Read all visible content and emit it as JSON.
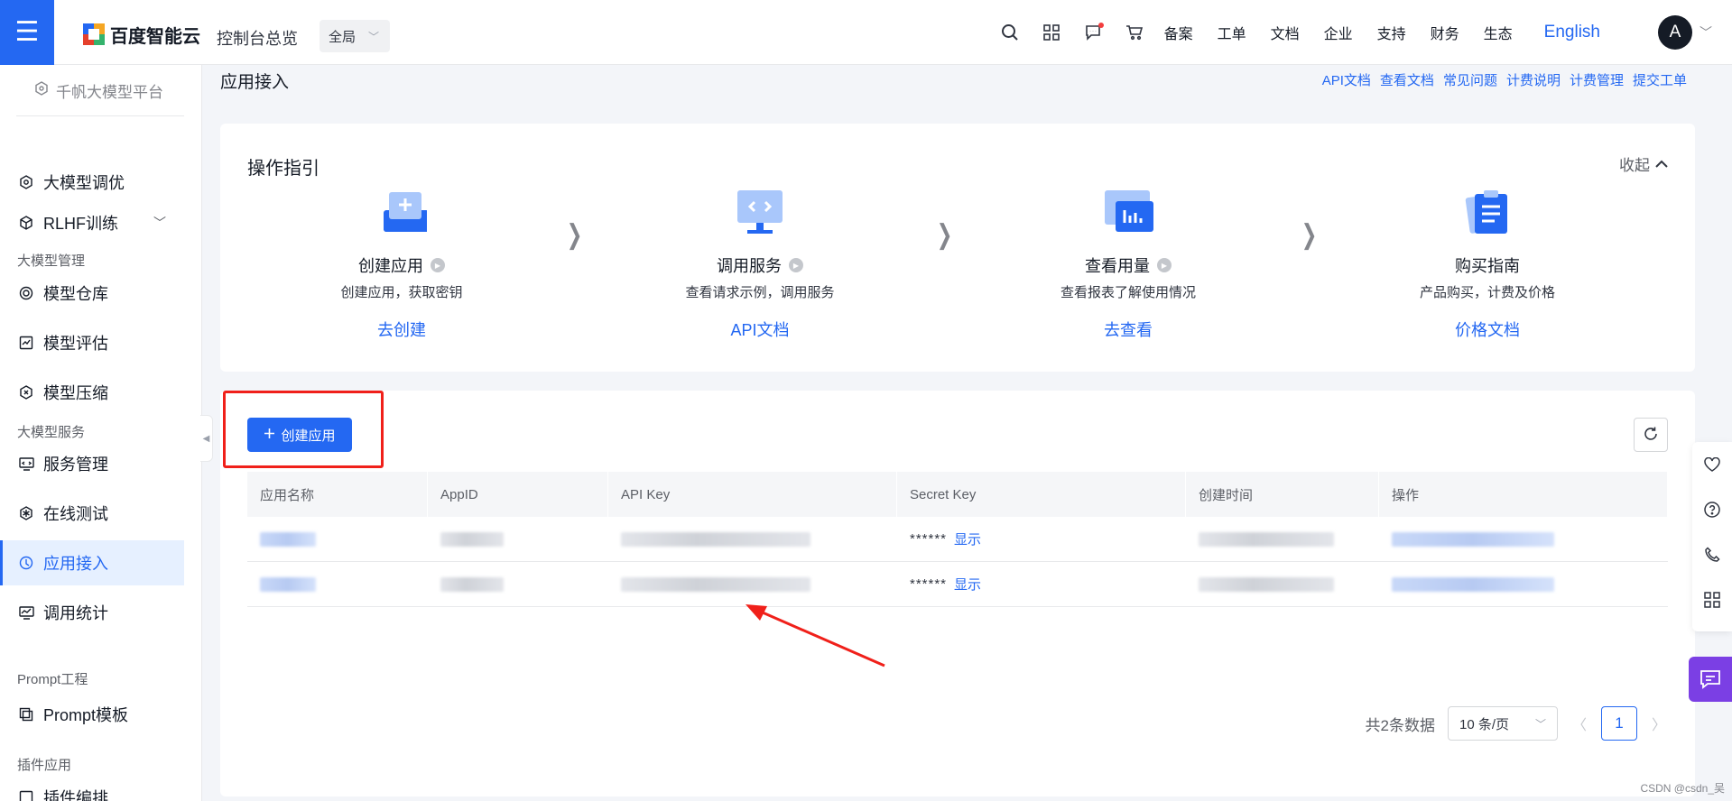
{
  "topbar": {
    "logo_text": "百度智能云",
    "console_title": "控制台总览",
    "region": "全局",
    "links": [
      "备案",
      "工单",
      "文档",
      "企业",
      "支持",
      "财务",
      "生态"
    ],
    "language": "English",
    "avatar_letter": "A",
    "icons": [
      "search-icon",
      "grid-icon",
      "message-icon",
      "cart-icon"
    ]
  },
  "sidebar": {
    "platform": "千帆大模型平台",
    "items": [
      {
        "label": "大模型调优",
        "icon": "tune-icon"
      },
      {
        "label": "RLHF训练",
        "icon": "cube-icon"
      },
      {
        "label": "模型仓库",
        "icon": "repo-icon"
      },
      {
        "label": "模型评估",
        "icon": "evaluate-icon"
      },
      {
        "label": "模型压缩",
        "icon": "compress-icon"
      },
      {
        "label": "服务管理",
        "icon": "service-icon"
      },
      {
        "label": "在线测试",
        "icon": "test-icon"
      },
      {
        "label": "应用接入",
        "icon": "app-icon"
      },
      {
        "label": "调用统计",
        "icon": "stats-icon"
      },
      {
        "label": "Prompt模板",
        "icon": "template-icon"
      },
      {
        "label": "插件编排",
        "icon": "plugin-icon"
      }
    ],
    "groups": [
      "大模型管理",
      "大模型服务",
      "Prompt工程",
      "插件应用"
    ]
  },
  "page": {
    "title": "应用接入",
    "doc_links": [
      "API文档",
      "查看文档",
      "常见问题",
      "计费说明",
      "计费管理",
      "提交工单"
    ]
  },
  "guide": {
    "title": "操作指引",
    "collapse_label": "收起",
    "steps": [
      {
        "title": "创建应用",
        "desc": "创建应用，获取密钥",
        "link": "去创建"
      },
      {
        "title": "调用服务",
        "desc": "查看请求示例，调用服务",
        "link": "API文档"
      },
      {
        "title": "查看用量",
        "desc": "查看报表了解使用情况",
        "link": "去查看"
      },
      {
        "title": "购买指南",
        "desc": "产品购买，计费及价格",
        "link": "价格文档"
      }
    ]
  },
  "table": {
    "create_label": "创建应用",
    "columns": [
      "应用名称",
      "AppID",
      "API Key",
      "Secret Key",
      "创建时间",
      "操作"
    ],
    "rows": [
      {
        "secret_mask": "******",
        "show_label": "显示"
      },
      {
        "secret_mask": "******",
        "show_label": "显示"
      }
    ]
  },
  "pagination": {
    "total_label": "共2条数据",
    "page_size": "10 条/页",
    "current_page": "1"
  },
  "watermark": "CSDN @csdn_吴",
  "colors": {
    "accent": "#2468f2",
    "highlight_red": "#f0201a",
    "chat_purple": "#7b3fe4"
  }
}
